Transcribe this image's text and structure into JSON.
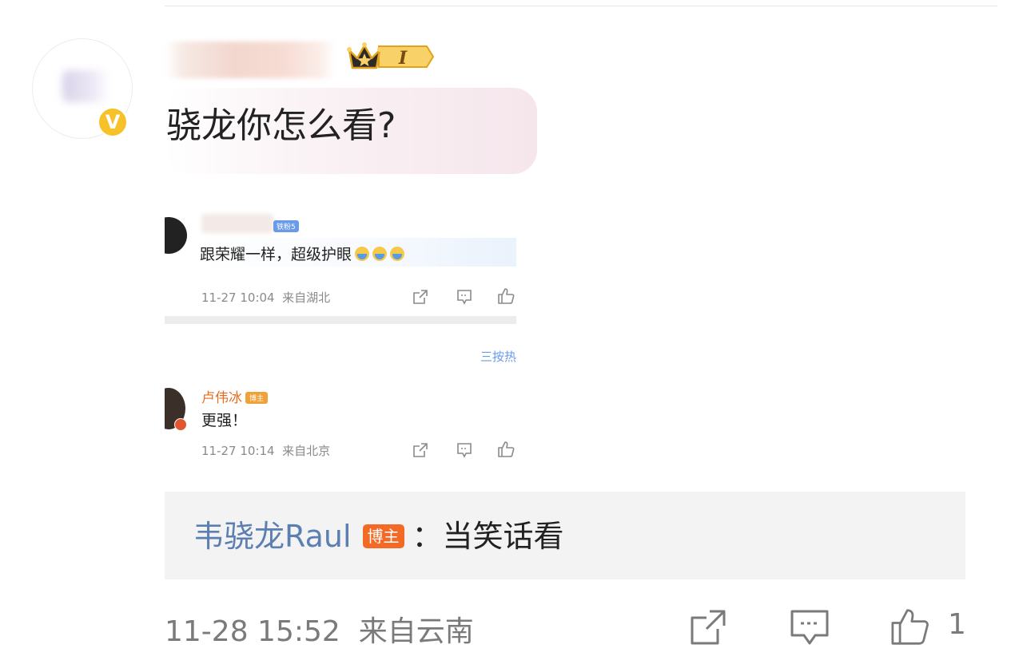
{
  "comment": {
    "text": "骁龙你怎么看?"
  },
  "badge": {
    "level": "I"
  },
  "embedded": {
    "comment1": {
      "fan_badge": "铁粉5",
      "text": "跟荣耀一样，超级护眼",
      "time": "11-27 10:04",
      "location": "来自湖北"
    },
    "sort_label": "三按热",
    "comment2": {
      "user": "卢伟冰",
      "badge": "博主",
      "text": "更强！",
      "time": "11-27 10:14",
      "location": "来自北京"
    }
  },
  "reply": {
    "author": "韦骁龙Raul",
    "badge": "博主",
    "separator": "：",
    "text": "当笑话看"
  },
  "meta": {
    "time": "11-28 15:52",
    "location": "来自云南",
    "like_count": "1"
  },
  "icons": [
    "share-icon",
    "comment-icon",
    "like-icon",
    "crown-icon",
    "verified-icon"
  ],
  "colors": {
    "verified": "#f7c12a",
    "reply_name": "#5b7fb0",
    "blogger_badge": "#f26a25",
    "reply_bg": "#f3f3f3"
  }
}
